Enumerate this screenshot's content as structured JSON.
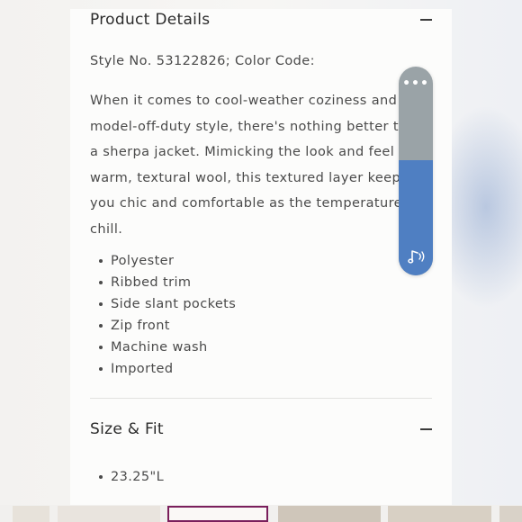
{
  "product_details": {
    "title": "Product Details",
    "style_line": "Style No. 53122826; Color Code:",
    "description_lines": [
      "When it comes to cool-weather coziness and",
      "model-off-duty style, there's nothing better t",
      "a sherpa jacket. Mimicking the look and feel",
      "warm, textural wool, this textured layer keep",
      "you chic and comfortable as the temperature",
      "chill."
    ],
    "features": [
      "Polyester",
      "Ribbed trim",
      "Side slant pockets",
      "Zip front",
      "Machine wash",
      "Imported"
    ]
  },
  "size_fit": {
    "title": "Size & Fit",
    "items": [
      "23.25\"L"
    ]
  },
  "accessibility_widget": {
    "level_fraction": 0.55,
    "more_glyph": "•••",
    "top_color": "#9aa3a7",
    "level_color": "#4f7fc2"
  },
  "colors": {
    "text": "#4a4a4a",
    "heading": "#2b2b2b",
    "card": "#fcfcfb"
  }
}
